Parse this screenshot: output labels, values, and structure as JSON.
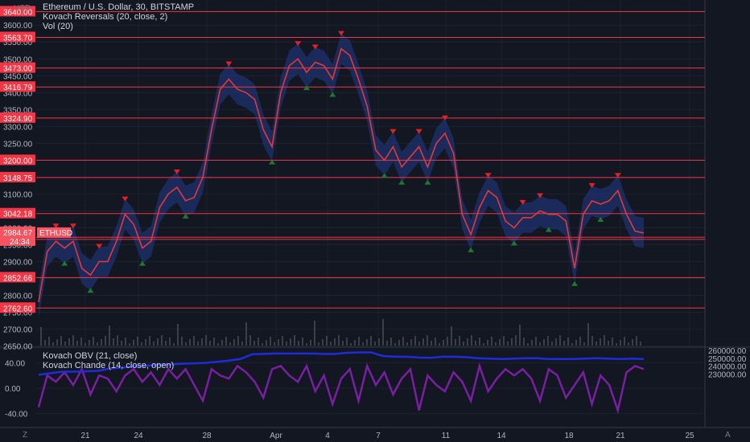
{
  "header": {
    "currency": "USD",
    "title": "Ethereum / U.S. Dollar, 30, BITSTAMP",
    "indicator1": "Kovach Reversals (20, close, 2)",
    "indicator2": "Vol (20)"
  },
  "lower_pane": {
    "indicator1": "Kovach OBV (21, close)",
    "indicator2": "Kovach Chande (14, close, open)"
  },
  "footer": {
    "left_icon": "Z",
    "right_icon": "A"
  },
  "colors": {
    "background": "#131722",
    "grid": "#1e2230",
    "level_line": "#f23645",
    "up_arrow": "#1b7a2f",
    "down_arrow": "#e0202a",
    "band": "#1f3a8a",
    "obv": "#1e2cdc",
    "chande": "#7b1fa2",
    "price_line": "#e53935"
  },
  "price_axis": {
    "ticks": [
      "3600.00",
      "3550.00",
      "3500.00",
      "3450.00",
      "3400.00",
      "3350.00",
      "3300.00",
      "3250.00",
      "3200.00",
      "3150.00",
      "3100.00",
      "3050.00",
      "3000.00",
      "2950.00",
      "2900.00",
      "2850.00",
      "2800.00",
      "2750.00",
      "2700.00",
      "2650.00"
    ],
    "levels": [
      "3640.00",
      "3563.70",
      "3473.00",
      "3416.79",
      "3324.90",
      "3200.00",
      "3148.75",
      "3042.18",
      "2965.84",
      "2852.66",
      "2762.60"
    ],
    "current_price": "2984.67",
    "current_symbol": "ETHUSD",
    "countdown": "24:34"
  },
  "osc_axis": {
    "left_ticks": [
      "40.00",
      "0.00",
      "-40.00"
    ],
    "right_ticks": [
      "260000.00",
      "250000.00",
      "240000.00",
      "230000.00"
    ]
  },
  "time_axis": {
    "labels": [
      "21",
      "24",
      "28",
      "Apr",
      "4",
      "7",
      "11",
      "14",
      "18",
      "21",
      "25"
    ]
  },
  "chart_data": {
    "type": "line",
    "title": "Ethereum / U.S. Dollar, 30, BITSTAMP",
    "xlabel": "",
    "ylabel": "USD",
    "ylim": [
      2650,
      3650
    ],
    "x_labels": [
      "21",
      "24",
      "28",
      "Apr",
      "4",
      "7",
      "11",
      "14",
      "18",
      "21",
      "25"
    ],
    "price_series": {
      "name": "ETHUSD",
      "x": [
        0,
        0.5,
        1,
        1.5,
        2,
        2.5,
        3,
        3.5,
        4,
        4.5,
        5,
        5.5,
        6,
        6.5,
        7,
        7.5,
        8,
        8.5,
        9,
        9.5,
        10,
        10.5,
        11,
        11.5,
        12,
        12.5,
        13,
        13.5,
        14,
        14.5,
        15,
        15.5,
        16,
        16.5,
        17,
        17.5,
        18,
        18.5,
        19,
        19.5,
        20,
        20.5,
        21,
        21.5,
        22,
        22.5,
        23,
        23.5,
        24,
        24.5,
        25,
        25.5,
        26,
        26.5,
        27,
        27.5,
        28,
        28.5,
        29,
        29.5,
        30,
        30.5,
        31,
        31.5,
        32,
        32.5,
        33,
        33.5,
        34,
        34.5,
        35
      ],
      "values": [
        2780,
        2930,
        2960,
        2940,
        2960,
        2880,
        2860,
        2900,
        2900,
        2960,
        3040,
        3010,
        2940,
        2960,
        3060,
        3100,
        3120,
        3080,
        3090,
        3150,
        3290,
        3410,
        3440,
        3410,
        3400,
        3380,
        3290,
        3240,
        3400,
        3480,
        3500,
        3460,
        3490,
        3480,
        3440,
        3530,
        3510,
        3440,
        3360,
        3230,
        3200,
        3240,
        3180,
        3210,
        3240,
        3180,
        3250,
        3280,
        3220,
        3040,
        2980,
        3060,
        3110,
        3090,
        3020,
        3000,
        3030,
        3030,
        3050,
        3040,
        3040,
        3020,
        2880,
        3040,
        3080,
        3070,
        3080,
        3110,
        3040,
        2990,
        2984.67
      ]
    },
    "chande_series": {
      "name": "Kovach Chande (14, close, open)",
      "values": [
        -30,
        20,
        10,
        25,
        5,
        30,
        -10,
        20,
        15,
        -5,
        20,
        30,
        10,
        25,
        5,
        30,
        15,
        30,
        5,
        -20,
        30,
        20,
        15,
        35,
        25,
        10,
        -15,
        30,
        35,
        20,
        10,
        35,
        -5,
        20,
        -25,
        15,
        30,
        -20,
        35,
        5,
        25,
        -10,
        15,
        30,
        -35,
        20,
        5,
        -5,
        25,
        10,
        -20,
        35,
        -5,
        15,
        30,
        20,
        30,
        15,
        -20,
        30,
        20,
        -15,
        5,
        25,
        -25,
        20,
        5,
        -35,
        25,
        35,
        30
      ]
    },
    "obv_series": {
      "name": "Kovach OBV (21, close)",
      "values": [
        229000,
        231000,
        233000,
        233000,
        233500,
        234000,
        237000,
        238000,
        240000,
        240500,
        241500,
        242000,
        243000,
        243500,
        244000,
        245500,
        247000,
        249000,
        255000,
        255500,
        256000,
        256000,
        256000,
        256000,
        255500,
        255500,
        257000,
        257500,
        257500,
        253000,
        252000,
        252000,
        251000,
        250500,
        252000,
        252000,
        251500,
        250000,
        249500,
        249000,
        249500,
        250000,
        250000,
        249000,
        249000,
        249000,
        249500,
        250000,
        249500,
        249000,
        249500,
        249000
      ]
    }
  }
}
